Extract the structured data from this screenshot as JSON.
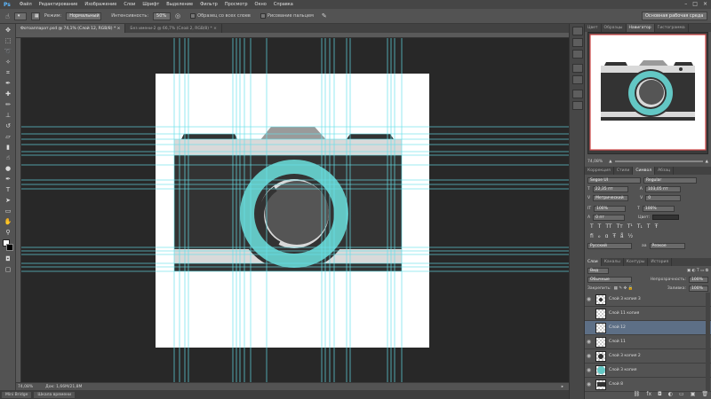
{
  "app": {
    "logo": "Ps"
  },
  "menu": [
    "Файл",
    "Редактирование",
    "Изображение",
    "Слои",
    "Шрифт",
    "Выделение",
    "Фильтр",
    "Просмотр",
    "Окно",
    "Справка"
  ],
  "options": {
    "mode_label": "Режим:",
    "mode_value": "Нормальный",
    "intensity_label": "Интенсивность:",
    "intensity_value": "50%",
    "sample_all_label": "Образец со всех слоев",
    "protect_tones_label": "Рисование пальцем"
  },
  "workspace": "Основная рабочая среда",
  "tabs": [
    {
      "label": "Фотоаппарат.psd @ 74,1% (Слой 12, RGB/8) * ×",
      "active": true
    },
    {
      "label": "Без имени-2 @ 66,7% (Слой 2, RGB/8) * ×",
      "active": false
    }
  ],
  "status": {
    "zoom": "74,08%",
    "doc": "Док: 1,66М/21,8М"
  },
  "bottom_tabs": [
    "Mini Bridge",
    "Шкала времени"
  ],
  "panels": {
    "nav_tabs": [
      "Цвет",
      "Образцы",
      "Навигатор",
      "Гистограмма"
    ],
    "nav_zoom": "74,08%",
    "char_tabs": [
      "Коррекция",
      "Стили",
      "Символ",
      "Абзац"
    ],
    "font_family": "Segoe UI",
    "font_style": "Regular",
    "font_size": "22,35 пт",
    "leading": "103,05 пт",
    "kerning": "Метрический",
    "tracking": "0",
    "vscale": "100%",
    "hscale": "100%",
    "baseline": "0 пт",
    "color_label": "Цвет:",
    "language": "Русский",
    "aa_label": "aa",
    "aa_value": "Резкое",
    "layers_tabs": [
      "Слои",
      "Каналы",
      "Контуры",
      "История"
    ],
    "kind_label": "Вид",
    "blend_mode": "Обычные",
    "opacity_label": "Непрозрачность:",
    "opacity_value": "100%",
    "lock_label": "Закрепить:",
    "fill_label": "Заливка:",
    "fill_value": "100%",
    "layers": [
      {
        "name": "Слой 3 копия 3",
        "selected": false,
        "visible": true,
        "thumb": "dot"
      },
      {
        "name": "Слой 11 копия",
        "selected": false,
        "visible": false,
        "thumb": "blank"
      },
      {
        "name": "Слой 12",
        "selected": true,
        "visible": false,
        "thumb": "blank"
      },
      {
        "name": "Слой 11",
        "selected": false,
        "visible": true,
        "thumb": "blank"
      },
      {
        "name": "Слой 3 копия 2",
        "selected": false,
        "visible": true,
        "thumb": "bigdot"
      },
      {
        "name": "Слой 3 копия",
        "selected": false,
        "visible": true,
        "thumb": "teal"
      },
      {
        "name": "Слой 8",
        "selected": false,
        "visible": true,
        "thumb": "dark"
      }
    ]
  },
  "colors": {
    "teal": "#63c7c4",
    "dark": "#333333",
    "grey": "#9a9a9a",
    "light": "#d9d9d9",
    "guide": "#66e0ea"
  }
}
